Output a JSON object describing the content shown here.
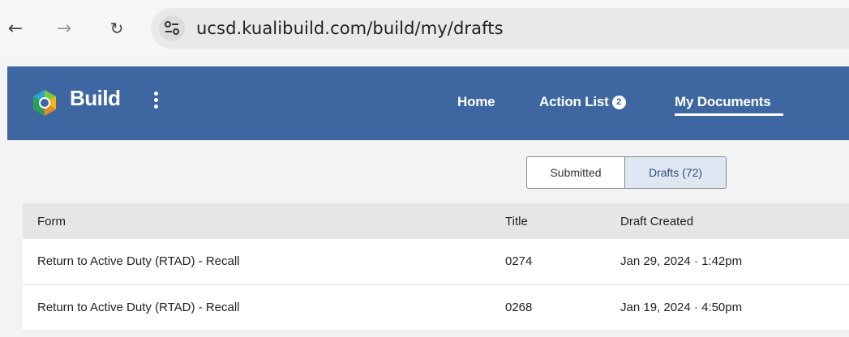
{
  "browser": {
    "url": "ucsd.kualibuild.com/build/my/drafts",
    "back_icon": "←",
    "forward_icon": "→",
    "reload_icon": "↻"
  },
  "header": {
    "brand": "Build",
    "nav": {
      "home": "Home",
      "action_list": "Action List",
      "action_list_badge": "2",
      "my_documents": "My Documents"
    },
    "colors": {
      "background": "#3e67a2"
    }
  },
  "tabs": {
    "submitted": "Submitted",
    "drafts": "Drafts (72)"
  },
  "table": {
    "columns": {
      "form": "Form",
      "title": "Title",
      "draft_created": "Draft Created"
    },
    "rows": [
      {
        "form": "Return to Active Duty (RTAD) - Recall",
        "title": "0274",
        "created": "Jan 29, 2024 · 1:42pm"
      },
      {
        "form": "Return to Active Duty (RTAD) - Recall",
        "title": "0268",
        "created": "Jan 19, 2024 · 4:50pm"
      }
    ]
  }
}
